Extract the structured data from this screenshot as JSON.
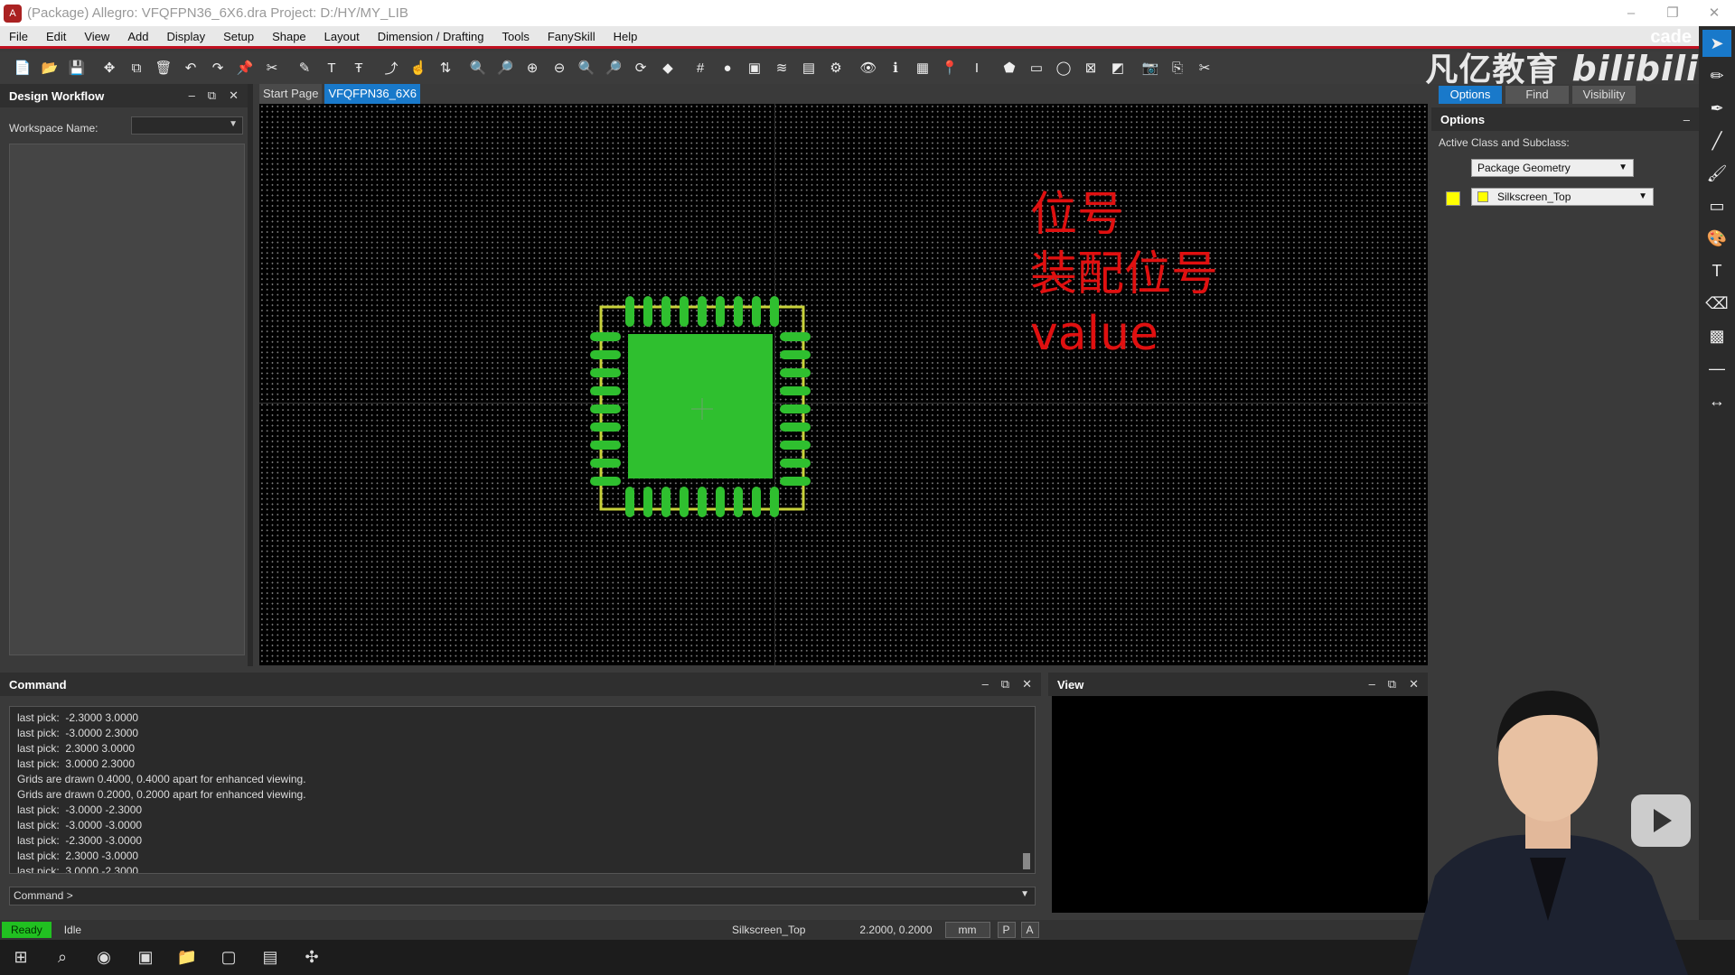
{
  "window": {
    "title": "(Package) Allegro: VFQFPN36_6X6.dra  Project: D:/HY/MY_LIB"
  },
  "menu": [
    "File",
    "Edit",
    "View",
    "Add",
    "Display",
    "Setup",
    "Shape",
    "Layout",
    "Dimension / Drafting",
    "Tools",
    "FanySkill",
    "Help"
  ],
  "brand": {
    "text": "凡亿教育",
    "bili": "bilibili",
    "cade": "cade"
  },
  "design_workflow": {
    "title": "Design Workflow",
    "workspace_label": "Workspace Name:"
  },
  "tabs": [
    {
      "label": "Start Page"
    },
    {
      "label": "VFQFPN36_6X6",
      "active": true
    }
  ],
  "annotation": {
    "line1": "位号",
    "line2": "装配位号",
    "line3": "value",
    "color": "#e01010"
  },
  "options": {
    "tabs": [
      "Options",
      "Find",
      "Visibility"
    ],
    "title": "Options",
    "active_class_label": "Active Class and Subclass:",
    "class_value": "Package Geometry",
    "subclass_value": "Silkscreen_Top",
    "subclass_color": "#ffff00"
  },
  "command": {
    "title": "Command",
    "log": [
      "last pick:  -2.3000 3.0000",
      "last pick:  -3.0000 2.3000",
      "last pick:  2.3000 3.0000",
      "last pick:  3.0000 2.3000",
      "Grids are drawn 0.4000, 0.4000 apart for enhanced viewing.",
      "Grids are drawn 0.2000, 0.2000 apart for enhanced viewing.",
      "last pick:  -3.0000 -2.3000",
      "last pick:  -3.0000 -3.0000",
      "last pick:  -2.3000 -3.0000",
      "last pick:  2.3000 -3.0000",
      "last pick:  3.0000 -2.3000"
    ],
    "prompt": "Command >"
  },
  "view_panel": {
    "title": "View"
  },
  "status": {
    "ready": "Ready",
    "state": "Idle",
    "layer": "Silkscreen_Top",
    "coords": "2.2000, 0.2000",
    "units": "mm",
    "p": "P",
    "a": "A"
  },
  "colors": {
    "pad": "#2fbf2f",
    "silkscreen": "#c8d23a",
    "accent": "#1979ca",
    "ready": "#21c021"
  }
}
